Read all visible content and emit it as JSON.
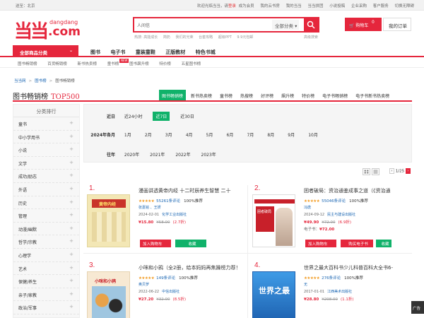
{
  "topbar": {
    "location": "送至：北京",
    "welcome": "欢迎光临当当，请",
    "login": "登录",
    "register": "成为会员",
    "links": [
      "我的云书房",
      "我的当当",
      "当当拼团",
      "小说投稿",
      "企业采购",
      "客户服务",
      "切换无障碍"
    ]
  },
  "brand": {
    "mark": "当当",
    "name1": "dangdang",
    "name2": ".com"
  },
  "search": {
    "value": "人间信",
    "category": "全部分类",
    "hotwords": [
      "热搜: 高能成长",
      "简奶",
      "我们的光荣",
      "台套攻略",
      "超级PPT",
      "9.9元包邮"
    ],
    "advanced": "高级搜索"
  },
  "cart": {
    "label": "购物车",
    "count": "0",
    "orders": "我的订单"
  },
  "nav": {
    "all_categories": "全部商品分类",
    "items": [
      "图书",
      "电子书",
      "童装童鞋",
      "正版教材",
      "特色书城"
    ],
    "sub": [
      "图书畅销榜",
      "百货畅销榜",
      "新书热卖榜",
      "童书榜",
      "图书飙升榜",
      "特价榜",
      "五星图书榜"
    ],
    "new_tag": "NEW"
  },
  "breadcrumb": [
    "当当网",
    "图书榜",
    "图书畅销榜"
  ],
  "page": {
    "title": "图书畅销榜",
    "title_suffix": "TOP500",
    "tabs": [
      "图书畅销榜",
      "新书热卖榜",
      "童书榜",
      "热搜榜",
      "好评榜",
      "飙升榜",
      "特价榜",
      "电子书畅销榜",
      "电子书新书热卖榜"
    ],
    "active_tab": 0
  },
  "sidebar": {
    "header": "分类排行",
    "items": [
      "童书",
      "中小学用书",
      "小说",
      "文学",
      "成功/励志",
      "外语",
      "历史",
      "管理",
      "动漫/幽默",
      "哲学/宗教",
      "心理学",
      "艺术",
      "保健/养生",
      "亲子/家教",
      "政治/军事"
    ]
  },
  "filter": {
    "recent_label": "近日",
    "recent": [
      "近24小时",
      "近7日",
      "近30日"
    ],
    "recent_active": 1,
    "month_label": "2024年各月",
    "months": [
      "1月",
      "2月",
      "3月",
      "4月",
      "5月",
      "6月",
      "7月",
      "8月",
      "9月",
      "10月"
    ],
    "year_label": "往年",
    "years": [
      "2020年",
      "2021年",
      "2022年",
      "2023年"
    ]
  },
  "pager": {
    "text": "1/25",
    "prev": "‹",
    "next": "›"
  },
  "products": [
    {
      "rank": "1.",
      "name": "漫画讲透黄帝内经 十二时辰养生智慧 二十",
      "stars": "★★★★★",
      "comments": "55261条评论",
      "recommend": "100%推荐",
      "author": "张嘉铭 、王妍",
      "date": "2024-02-01",
      "publisher": "化学工业出版社",
      "price": "¥15.80",
      "old_price": "¥58.00",
      "discount": "(2.7折)",
      "ebook_label": "",
      "ebook_price": "",
      "buy": "加入购物车",
      "fav": "收藏",
      "cover": "#f0e6b8",
      "cover_text": "黄帝内经"
    },
    {
      "rank": "2.",
      "name": "困者破局：资治通鉴成事之道（《资治通",
      "stars": "★★★★★",
      "comments": "55046条评论",
      "recommend": "100%推荐",
      "author": "冯唐",
      "date": "2024-09-12",
      "publisher": "民主与建设出版社",
      "price": "¥49.90",
      "old_price": "¥72.00",
      "discount": "(6.9折)",
      "ebook_label": "电子书：",
      "ebook_price": "¥72.00",
      "buy": "加入购物车",
      "fav": "购买电子书",
      "cover": "#c8202a",
      "cover_text": "困者破局"
    },
    {
      "rank": "3.",
      "name": "小咪和小鸦（全2册，给本妈妈再焦躁榜力荐！",
      "stars": "★★★★★",
      "comments": "149条评论",
      "recommend": "100%推荐",
      "author": "奥贝罗",
      "date": "2022-06-22",
      "publisher": "中信出版社",
      "price": "¥27.20",
      "old_price": "¥32.00",
      "discount": "(8.5折)",
      "ebook_label": "",
      "ebook_price": "",
      "buy": "加入购物车",
      "fav": "收藏",
      "cover": "#d9472a",
      "cover_text": "小咪和小鸦"
    },
    {
      "rank": "4.",
      "name": "世界之最大百科书少儿科普百科大全书6-",
      "stars": "★★★★★",
      "comments": "276条评论",
      "recommend": "100%推荐",
      "author": "无",
      "date": "2017-01-01",
      "publisher": "江西美术出版社",
      "price": "¥28.80",
      "old_price": "¥298.00",
      "discount": "(1.1折)",
      "ebook_label": "",
      "ebook_price": "",
      "buy": "加入购物车",
      "fav": "收藏",
      "cover": "#2a7fd0",
      "cover_text": "世界之最"
    }
  ],
  "float_ad": "广告"
}
